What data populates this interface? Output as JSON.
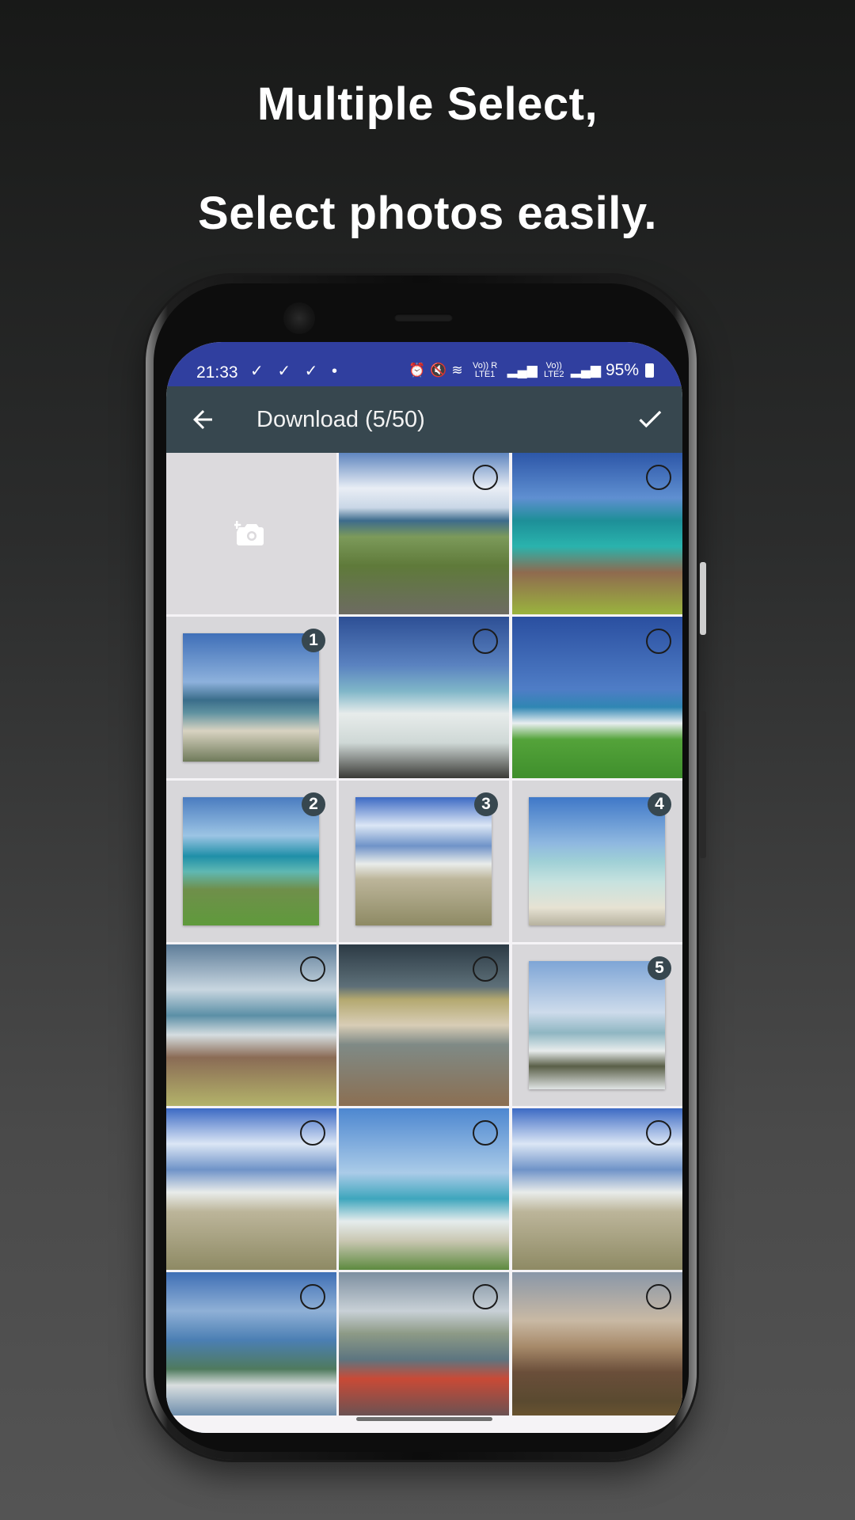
{
  "promo": {
    "line1": "Multiple Select,",
    "line2": "Select photos easily."
  },
  "status_bar": {
    "time": "21:33",
    "notification_icons": "✓ ✓ ✓ •",
    "net1": "Vo)) R LTE1",
    "net2": "Vo)) LTE2",
    "battery": "95%"
  },
  "toolbar": {
    "title": "Download (5/50)",
    "back_icon": "arrow-left-icon",
    "done_icon": "check-icon"
  },
  "grid": {
    "camera_tile_icon": "add-photo-icon",
    "photos": [
      {
        "id": "p01",
        "scene": "road-coast",
        "selected": false,
        "order": ""
      },
      {
        "id": "p02",
        "scene": "rocky-cove",
        "selected": false,
        "order": ""
      },
      {
        "id": "p03",
        "scene": "calm-bay",
        "selected": true,
        "order": "1"
      },
      {
        "id": "p04",
        "scene": "white-beach",
        "selected": false,
        "order": ""
      },
      {
        "id": "p05",
        "scene": "green-shore",
        "selected": false,
        "order": ""
      },
      {
        "id": "p06",
        "scene": "turquoise-bay",
        "selected": true,
        "order": "2"
      },
      {
        "id": "p07",
        "scene": "dune-beach",
        "selected": true,
        "order": "3"
      },
      {
        "id": "p08",
        "scene": "clear-lagoon",
        "selected": true,
        "order": "4"
      },
      {
        "id": "p09",
        "scene": "rocky-surf",
        "selected": false,
        "order": ""
      },
      {
        "id": "p10",
        "scene": "low-tide",
        "selected": false,
        "order": ""
      },
      {
        "id": "p11",
        "scene": "pale-beach",
        "selected": true,
        "order": "5"
      },
      {
        "id": "p12",
        "scene": "dune-beach",
        "selected": false,
        "order": ""
      },
      {
        "id": "p13",
        "scene": "grass-beach",
        "selected": false,
        "order": ""
      },
      {
        "id": "p14",
        "scene": "dune-beach",
        "selected": false,
        "order": ""
      },
      {
        "id": "p15",
        "scene": "village-coast",
        "selected": false,
        "order": ""
      },
      {
        "id": "p16",
        "scene": "harbour-boats",
        "selected": false,
        "order": ""
      },
      {
        "id": "p17",
        "scene": "church-sunset",
        "selected": false,
        "order": ""
      }
    ]
  },
  "colors": {
    "status_bar": "#303f9f",
    "toolbar": "#37474f",
    "badge": "#37474f",
    "camera_tile": "#dcdadd"
  }
}
